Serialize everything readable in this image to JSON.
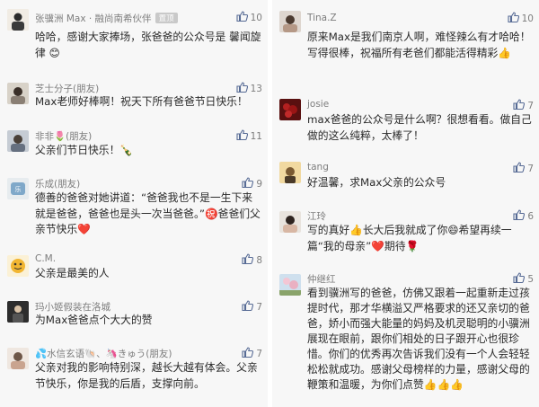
{
  "left": {
    "comments": [
      {
        "name": "张骥洲 Max · 融尚南希伙伴",
        "badge": "置顶",
        "likes": "10",
        "text": "哈哈，感谢大家捧场，张爸爸的公众号是 馨闻旋律 😊"
      },
      {
        "name": "芝士分子(朋友)",
        "likes": "13",
        "text": "Max老师好棒啊！祝天下所有爸爸节日快乐！"
      },
      {
        "name": "非非🌷(朋友)",
        "likes": "11",
        "text": "父亲们节日快乐！🍾"
      },
      {
        "name": "乐成(朋友)",
        "likes": "9",
        "text": "德善的爸爸对她讲道：“爸爸我也不是一生下来就是爸爸，爸爸也是头一次当爸爸。”㊗️爸爸们父亲节快乐❤️"
      },
      {
        "name": "C.M.",
        "likes": "8",
        "text": "父亲是最美的人"
      },
      {
        "name": "玛小姬假装在洛城",
        "likes": "7",
        "text": "为Max爸爸点个大大的赞"
      },
      {
        "name": "💦水信玄语🐚、🦄きゅう(朋友)",
        "likes": "7",
        "text": "父亲对我的影响特别深，越长大越有体会。父亲节快乐，你是我的后盾，支撑向前。"
      }
    ]
  },
  "right": {
    "comments": [
      {
        "name": "Tina.Z",
        "likes": "10",
        "text": "原来Max是我们南京人啊，难怪辣么有才哈哈！写得很棒，祝福所有老爸们都能活得精彩👍"
      },
      {
        "name": "josie",
        "likes": "7",
        "text": "max爸爸的公众号是什么啊？很想看看。做自己做的这么纯粹，太棒了！"
      },
      {
        "name": "tang",
        "likes": "7",
        "text": "好温馨，求Max父亲的公众号"
      },
      {
        "name": "江玲",
        "likes": "6",
        "text": "写的真好👍长大后我就成了你😄希望再续一篇“我的母亲”❤️期待🌹"
      },
      {
        "name": "仲继红",
        "likes": "5",
        "text": "看到骥洲写的爸爸，仿佛又跟着一起重新走过孩提时代，那才华横溢又严格要求的还又亲切的爸爸，娇小而强大能量的妈妈及机灵聪明的小骥洲展现在眼前，跟你们相处的日子跟开心也很珍惜。你们的优秀再次告诉我们没有一个人会轻轻松松就成功。感谢父母榜样的力量，感谢父母的鞭策和温暖，为你们点赞👍👍👍"
      }
    ]
  },
  "colors": {
    "background": "#f7f7f7",
    "meta": "#7d7d7d",
    "text": "#2a2a2a",
    "badge": "#c9c9c9",
    "like_icon": "#576b95"
  }
}
